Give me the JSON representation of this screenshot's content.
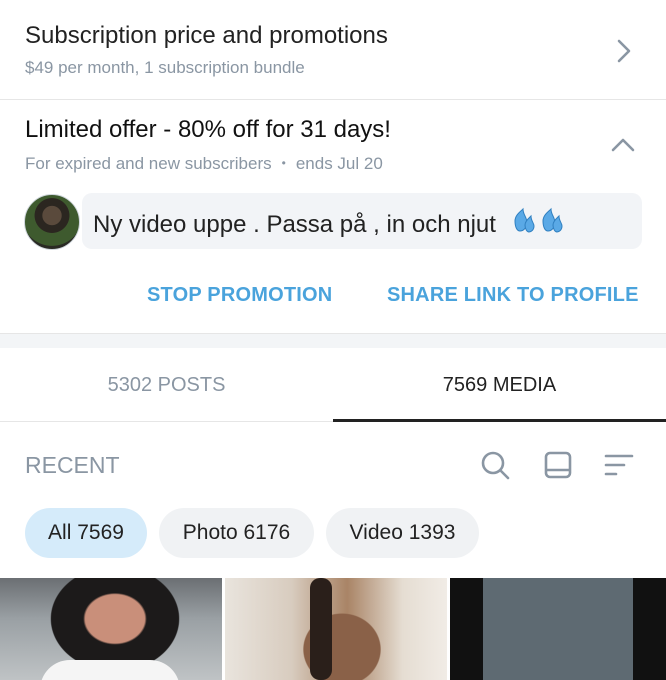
{
  "subscription": {
    "title": "Subscription price and promotions",
    "subtitle": "$49 per month, 1 subscription bundle"
  },
  "promotion": {
    "title": "Limited offer - 80% off for 31 days!",
    "audience": "For expired and new subscribers",
    "separator": "•",
    "ends": "ends Jul 20",
    "message": "Ny video uppe . Passa på , in och njut",
    "stop_label": "STOP PROMOTION",
    "share_label": "SHARE LINK TO PROFILE"
  },
  "tabs": [
    {
      "label": "5302 POSTS",
      "active": false
    },
    {
      "label": "7569 MEDIA",
      "active": true
    }
  ],
  "recent": {
    "label": "RECENT"
  },
  "filters": [
    {
      "label": "All 7569",
      "selected": true
    },
    {
      "label": "Photo 6176",
      "selected": false
    },
    {
      "label": "Video 1393",
      "selected": false
    }
  ],
  "colors": {
    "accent": "#4aa3dc",
    "muted": "#8a96a3",
    "chip_selected": "#d5ebfa",
    "chip": "#f0f2f4"
  },
  "icons": [
    "chevron-right-icon",
    "chevron-up-icon",
    "sweat-droplets-icon",
    "search-icon",
    "layout-icon",
    "sort-icon"
  ]
}
